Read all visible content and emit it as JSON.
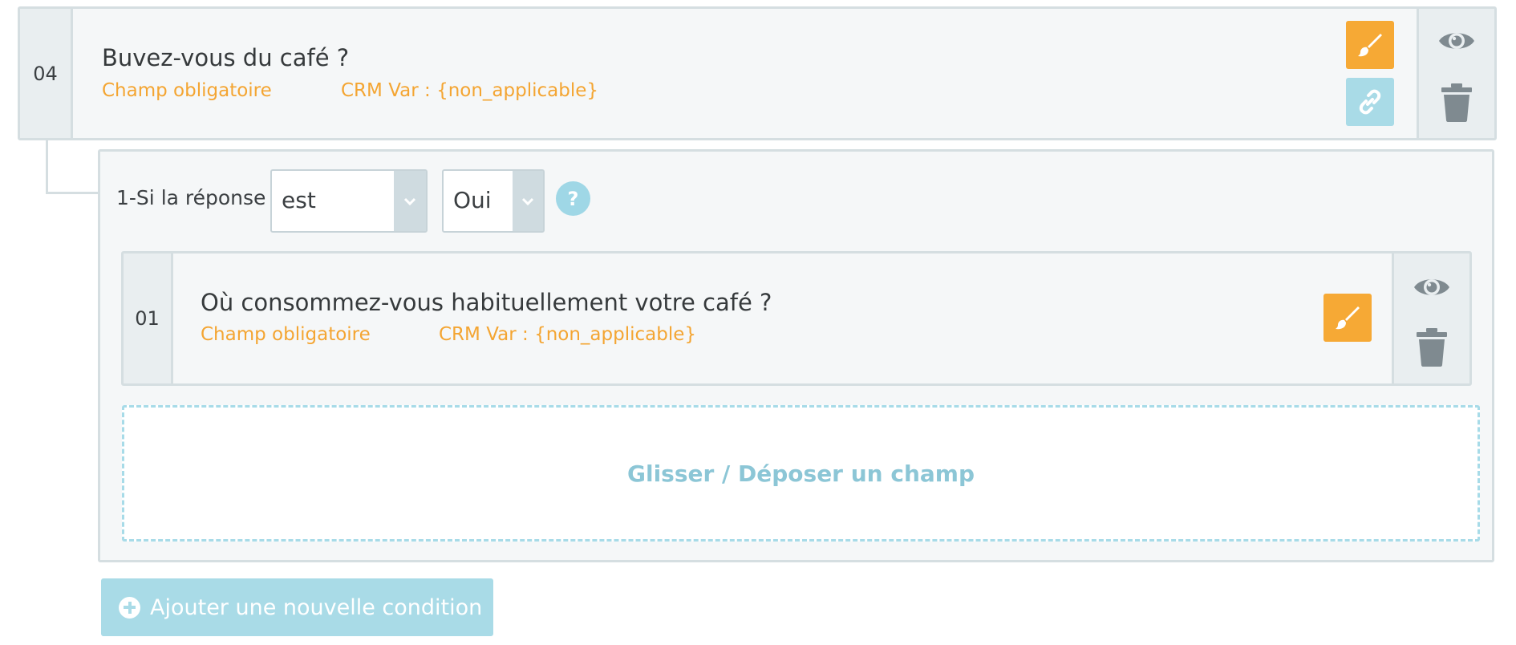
{
  "question_main": {
    "number": "04",
    "title": "Buvez-vous du café ?",
    "required_label": "Champ obligatoire",
    "crm_var": "CRM Var : {non_applicable}"
  },
  "condition": {
    "label": "1-Si la réponse",
    "operator_value": "est",
    "answer_value": "Oui",
    "help_glyph": "?"
  },
  "question_nested": {
    "number": "01",
    "title": "Où consommez-vous habituellement votre café ?",
    "required_label": "Champ obligatoire",
    "crm_var": "CRM Var : {non_applicable}"
  },
  "dropzone": {
    "label": "Glisser / Déposer un champ"
  },
  "add_condition": {
    "label": "Ajouter une nouvelle condition",
    "icon": "plus-circle-icon"
  },
  "icons": {
    "edit": "paintbrush-icon",
    "link": "link-icon",
    "visibility": "eye-icon",
    "delete": "trash-icon"
  },
  "colors": {
    "accent_orange": "#f6a935",
    "meta_orange": "#f4a532",
    "accent_blue": "#a9dbe7",
    "icon_gray": "#7f8a90"
  }
}
